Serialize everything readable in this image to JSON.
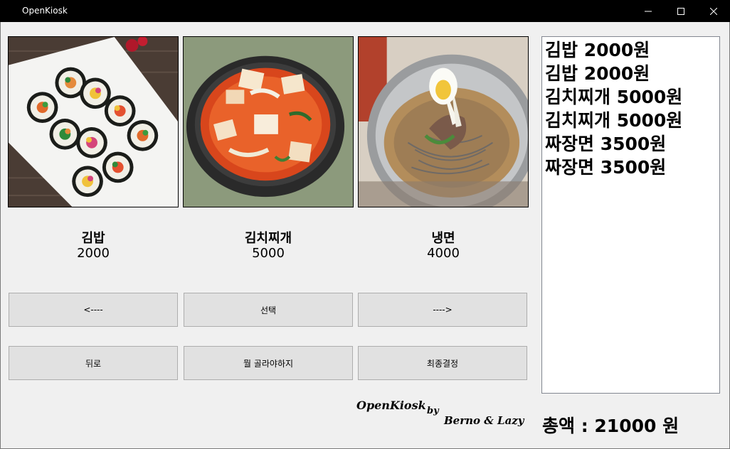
{
  "window": {
    "title": "OpenKiosk",
    "min_icon": "minimize-icon",
    "max_icon": "maximize-icon",
    "close_icon": "close-icon"
  },
  "menu": [
    {
      "name": "김밥",
      "price": "2000",
      "image": "gimbap-photo"
    },
    {
      "name": "김치찌개",
      "price": "5000",
      "image": "kimchi-stew-photo"
    },
    {
      "name": "냉면",
      "price": "4000",
      "image": "naengmyeon-photo"
    }
  ],
  "buttons": {
    "prev": "<----",
    "select": "선택",
    "next": "---->",
    "back": "뒤로",
    "what_to_choose": "뭘 골라야하지",
    "final": "최종결정"
  },
  "order_list": [
    "김밥 2000원",
    "김밥 2000원",
    "김치찌개 5000원",
    "김치찌개 5000원",
    "짜장면 3500원",
    "짜장면 3500원"
  ],
  "credits": {
    "app": "OpenKiosk",
    "by": "by",
    "authors": "Berno & Lazy"
  },
  "total": {
    "label": "총액 : 21000 원"
  },
  "colors": {
    "titlebar": "#000000",
    "window_bg": "#f0f0f0",
    "button_bg": "#e1e1e1",
    "button_border": "#adadad"
  }
}
